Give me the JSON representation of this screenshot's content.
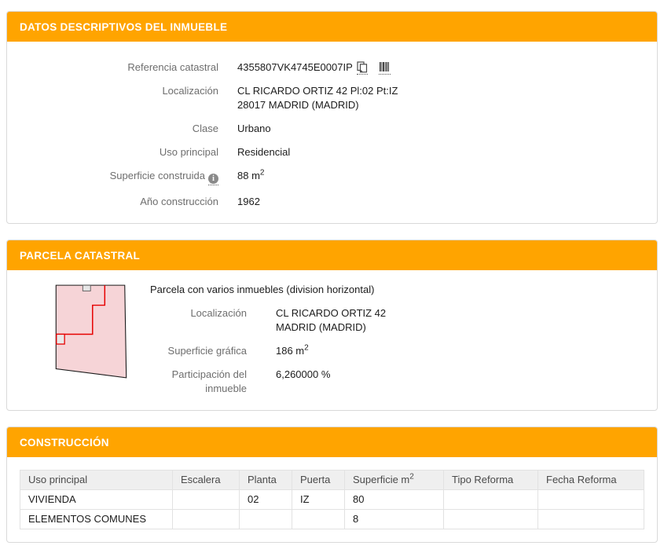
{
  "theme": {
    "accent_color": "#FFA400",
    "parcel_fill": "#F6D4D7",
    "parcel_line": "#E60000"
  },
  "sections": {
    "descriptive": {
      "title": "DATOS DESCRIPTIVOS DEL INMUEBLE",
      "referencia": {
        "label": "Referencia catastral",
        "value": "4355807VK4745E0007IP",
        "copy_icon": "copy-to-clipboard",
        "barcode_icon": "barcode"
      },
      "localizacion": {
        "label": "Localización",
        "line1": "CL RICARDO ORTIZ 42 Pl:02 Pt:IZ",
        "line2": "28017 MADRID (MADRID)"
      },
      "clase": {
        "label": "Clase",
        "value": "Urbano"
      },
      "uso_principal": {
        "label": "Uso principal",
        "value": "Residencial"
      },
      "superficie_construida": {
        "label": "Superficie construida",
        "info_icon": "info",
        "value": "88 m",
        "sup": "2"
      },
      "anio_construccion": {
        "label": "Año construcción",
        "value": "1962"
      }
    },
    "parcela": {
      "title": "PARCELA CATASTRAL",
      "sketch_icon": "parcel-outline-sketch",
      "descripcion": "Parcela con varios inmuebles (division horizontal)",
      "localizacion": {
        "label": "Localización",
        "line1": "CL RICARDO ORTIZ 42",
        "line2": "MADRID (MADRID)"
      },
      "superficie_grafica": {
        "label": "Superficie gráfica",
        "value": "186 m",
        "sup": "2"
      },
      "participacion": {
        "label": "Participación del inmueble",
        "value": "6,260000 %"
      }
    },
    "construccion": {
      "title": "CONSTRUCCIÓN",
      "table": {
        "headers": [
          "Uso principal",
          "Escalera",
          "Planta",
          "Puerta",
          "Superficie m",
          "Tipo Reforma",
          "Fecha Reforma"
        ],
        "superficie_header_sup": "2",
        "rows": [
          [
            "VIVIENDA",
            "",
            "02",
            "IZ",
            "80",
            "",
            ""
          ],
          [
            "ELEMENTOS COMUNES",
            "",
            "",
            "",
            "8",
            "",
            ""
          ]
        ]
      }
    }
  }
}
